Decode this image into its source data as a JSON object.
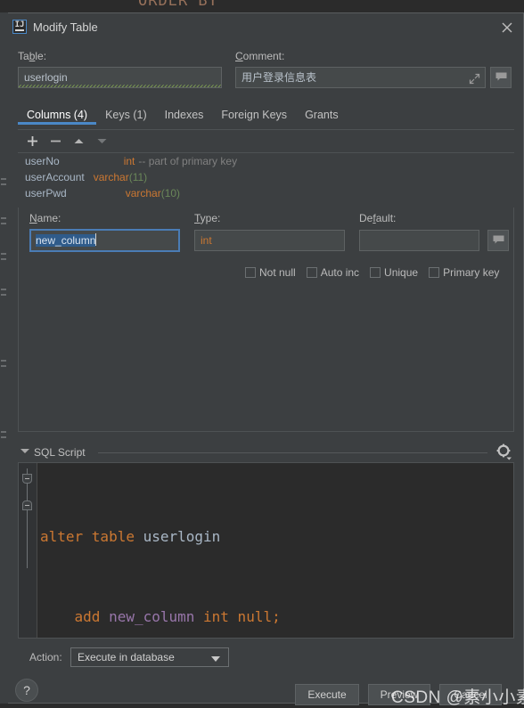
{
  "background": {
    "editor_sql_fragment": "ORDER BY"
  },
  "dialog": {
    "title": "Modify Table",
    "app_icon": "intellij-idea-icon",
    "close_icon": "close-icon",
    "table": {
      "label": "Table:",
      "label_mnemonic": "b",
      "value": "userlogin"
    },
    "comment": {
      "label": "Comment:",
      "label_mnemonic": "C",
      "value": "用户登录信息表",
      "expand_icon": "expand-icon",
      "comment_button_icon": "comment-bubble-icon"
    },
    "tabs": [
      {
        "label": "Columns (4)",
        "active": true
      },
      {
        "label": "Keys (1)",
        "active": false
      },
      {
        "label": "Indexes",
        "active": false
      },
      {
        "label": "Foreign Keys",
        "active": false
      },
      {
        "label": "Grants",
        "active": false
      }
    ],
    "column_toolbar": [
      {
        "name": "add-column-button",
        "icon": "plus-icon",
        "enabled": true
      },
      {
        "name": "remove-column-button",
        "icon": "minus-icon",
        "enabled": true
      },
      {
        "name": "move-up-button",
        "icon": "arrow-up-icon",
        "enabled": true
      },
      {
        "name": "move-down-button",
        "icon": "arrow-down-icon",
        "enabled": false
      }
    ],
    "columns": [
      {
        "name": "userNo",
        "type": "int",
        "length": "",
        "note": "-- part of primary key"
      },
      {
        "name": "userAccount",
        "type": "varchar",
        "length": "(11)",
        "note": ""
      },
      {
        "name": "userPwd",
        "type": "varchar",
        "length": "(10)",
        "note": ""
      }
    ],
    "column_editor": {
      "name": {
        "label": "Name:",
        "label_mnemonic": "N",
        "value": "new_column",
        "selected": true
      },
      "type": {
        "label": "Type:",
        "label_mnemonic": "T",
        "value": "int"
      },
      "default": {
        "label": "Default:",
        "label_mnemonic": "f",
        "value": "",
        "comment_button_icon": "comment-bubble-icon"
      },
      "checkboxes": [
        {
          "label": "Not null",
          "mnemonic": "u",
          "checked": false
        },
        {
          "label": "Auto inc",
          "mnemonic": "n",
          "checked": false
        },
        {
          "label": "Unique",
          "mnemonic": "U",
          "checked": false
        },
        {
          "label": "Primary key",
          "mnemonic": "P",
          "checked": false
        }
      ]
    },
    "sql_script": {
      "title": "SQL Script",
      "title_mnemonic": "S",
      "collapsed": false,
      "settings_icon": "gear-icon",
      "lines": [
        {
          "tokens": [
            {
              "text": "alter table ",
              "kind": "keyword"
            },
            {
              "text": "userlogin",
              "kind": "table"
            }
          ]
        },
        {
          "tokens": [
            {
              "text": "    add ",
              "kind": "keyword"
            },
            {
              "text": "new_column",
              "kind": "identifier"
            },
            {
              "text": " int null;",
              "kind": "keyword"
            }
          ]
        }
      ]
    },
    "footer": {
      "action_label": "Action:",
      "action_value": "Execute in database",
      "help_label": "?",
      "execute_label": "Execute",
      "preview_label": "Preview",
      "cancel_label": "Cancel"
    }
  },
  "watermark": "CSDN @素小小素",
  "colors": {
    "panel_bg": "#3c3f41",
    "editor_bg": "#2b2b2b",
    "accent_blue": "#4a88c7",
    "keyword_orange": "#cc7832",
    "identifier_purple": "#9876aa",
    "table_gray": "#a9b7c6",
    "length_green": "#6a8759",
    "selection_blue": "#2f5b8a"
  }
}
